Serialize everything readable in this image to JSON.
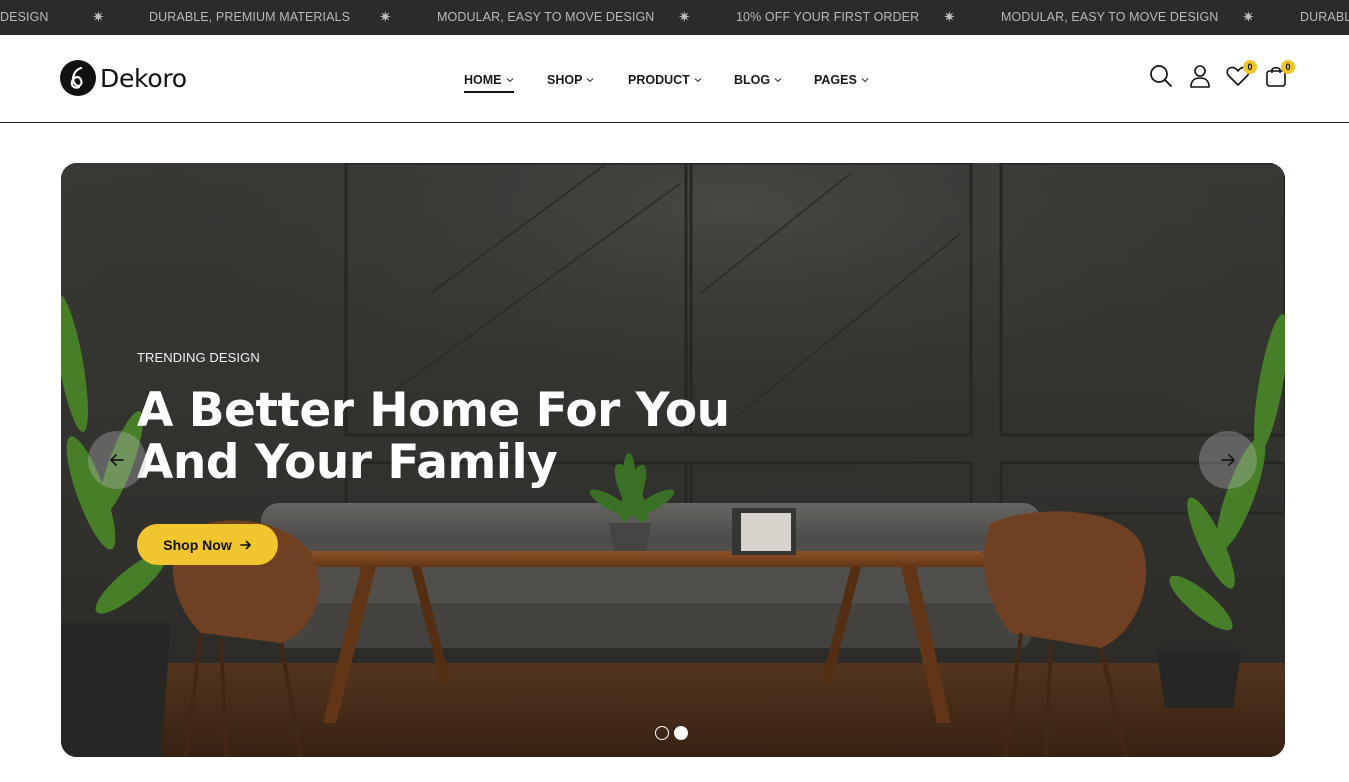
{
  "announcement": {
    "items": [
      "DESIGN",
      "DURABLE, PREMIUM MATERIALS",
      "MODULAR, EASY TO MOVE DESIGN",
      "10% OFF YOUR FIRST ORDER",
      "MODULAR, EASY TO MOVE DESIGN",
      "DURABLE"
    ],
    "separator": "✷"
  },
  "header": {
    "logo_text": "Dekoro",
    "nav": [
      {
        "label": "HOME",
        "active": true
      },
      {
        "label": "SHOP",
        "active": false
      },
      {
        "label": "PRODUCT",
        "active": false
      },
      {
        "label": "BLOG",
        "active": false
      },
      {
        "label": "PAGES",
        "active": false
      }
    ],
    "icons": [
      "search-icon",
      "user-icon",
      "heart-icon",
      "cart-icon"
    ],
    "wishlist_count": "0",
    "cart_count": "0"
  },
  "hero": {
    "eyebrow": "TRENDING DESIGN",
    "headline_line1": "A Better Home For You",
    "headline_line2": "And Your Family",
    "cta_label": "Shop Now",
    "slide_count": 2,
    "active_slide": 2
  },
  "colors": {
    "accent": "#f0c52d",
    "announcement_bg": "#2b2b2b",
    "text": "#111111"
  }
}
